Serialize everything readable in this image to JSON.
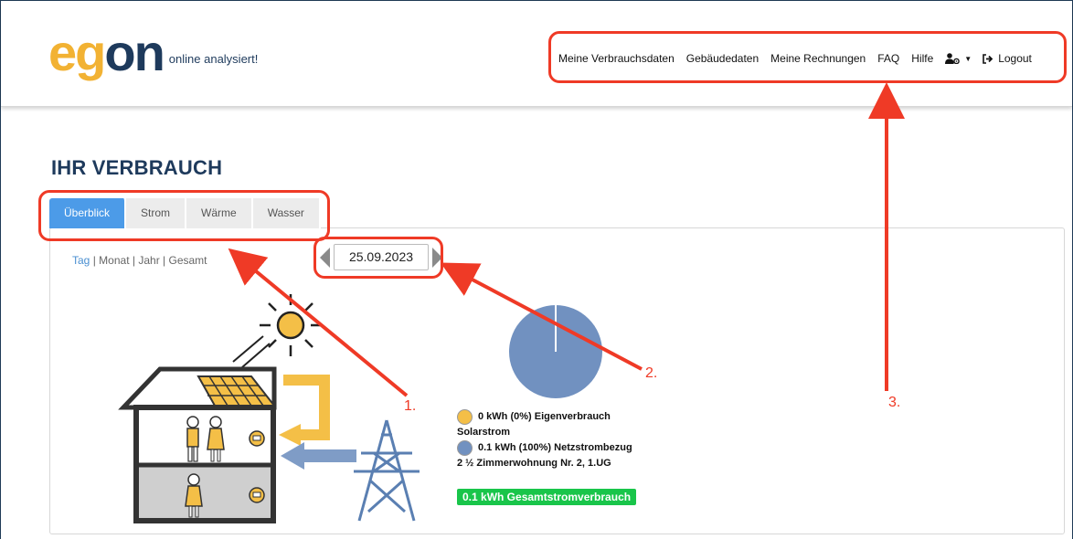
{
  "brand": {
    "logo_e": "e",
    "logo_g": "g",
    "logo_on": "on",
    "tagline": "online analysiert!"
  },
  "nav": {
    "items": [
      "Meine Verbrauchsdaten",
      "Gebäudedaten",
      "Meine Rechnungen",
      "FAQ",
      "Hilfe"
    ],
    "user_icon": "user-gear-icon",
    "logout_label": "Logout"
  },
  "page": {
    "title": "IHR VERBRAUCH"
  },
  "tabs": [
    {
      "label": "Überblick",
      "active": true
    },
    {
      "label": "Strom",
      "active": false
    },
    {
      "label": "Wärme",
      "active": false
    },
    {
      "label": "Wasser",
      "active": false
    }
  ],
  "period": {
    "day": "Tag",
    "month": "Monat",
    "year": "Jahr",
    "total": "Gesamt",
    "separator": "|"
  },
  "date": {
    "value": "25.09.2023"
  },
  "legend": {
    "solar": "0 kWh (0%) Eigenverbrauch",
    "solar_cont": "Solarstrom",
    "grid": "0.1 kWh (100%) Netzstrombezug",
    "unit": "2 ½ Zimmerwohnung Nr. 2, 1.UG",
    "total": "0.1 kWh Gesamtstromverbrauch"
  },
  "chart_data": {
    "type": "pie",
    "slices": [
      {
        "label": "Eigenverbrauch Solarstrom",
        "value": 0,
        "percent": 0,
        "color": "#f4bf47"
      },
      {
        "label": "Netzstrombezug",
        "value": 0.1,
        "percent": 100,
        "color": "#7191c0"
      }
    ]
  },
  "annotations": [
    "1.",
    "2.",
    "3."
  ],
  "colors": {
    "accent": "#4c9be8",
    "brand_yellow": "#f2b233",
    "brand_navy": "#1e3a5c",
    "highlight_red": "#ef3a26",
    "total_green": "#19c54a",
    "pie_blue": "#7191c0"
  }
}
